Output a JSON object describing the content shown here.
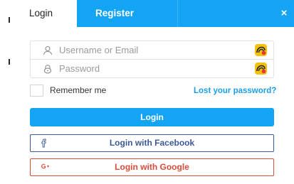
{
  "tabs": {
    "login_label": "Login",
    "register_label": "Register",
    "close_glyph": "×"
  },
  "form": {
    "username": {
      "placeholder": "Username or Email",
      "value": ""
    },
    "password": {
      "placeholder": "Password",
      "value": ""
    },
    "remember_label": "Remember me",
    "remember_checked": false,
    "lost_password_label": "Lost your password?",
    "login_button_label": "Login"
  },
  "social": {
    "facebook_label": "Login with Facebook",
    "google_label": "Login with Google",
    "facebook_icon": "facebook-icon",
    "google_icon": "google-plus-icon"
  },
  "icons": {
    "user_icon": "user-icon",
    "lock_icon": "lock-icon",
    "password_manager_icon": "password-manager-icon"
  },
  "colors": {
    "accent": "#14a4f4",
    "link": "#1a9ee6",
    "facebook": "#3b5998",
    "google": "#dd4b39",
    "password_manager": "#f4c20d"
  }
}
